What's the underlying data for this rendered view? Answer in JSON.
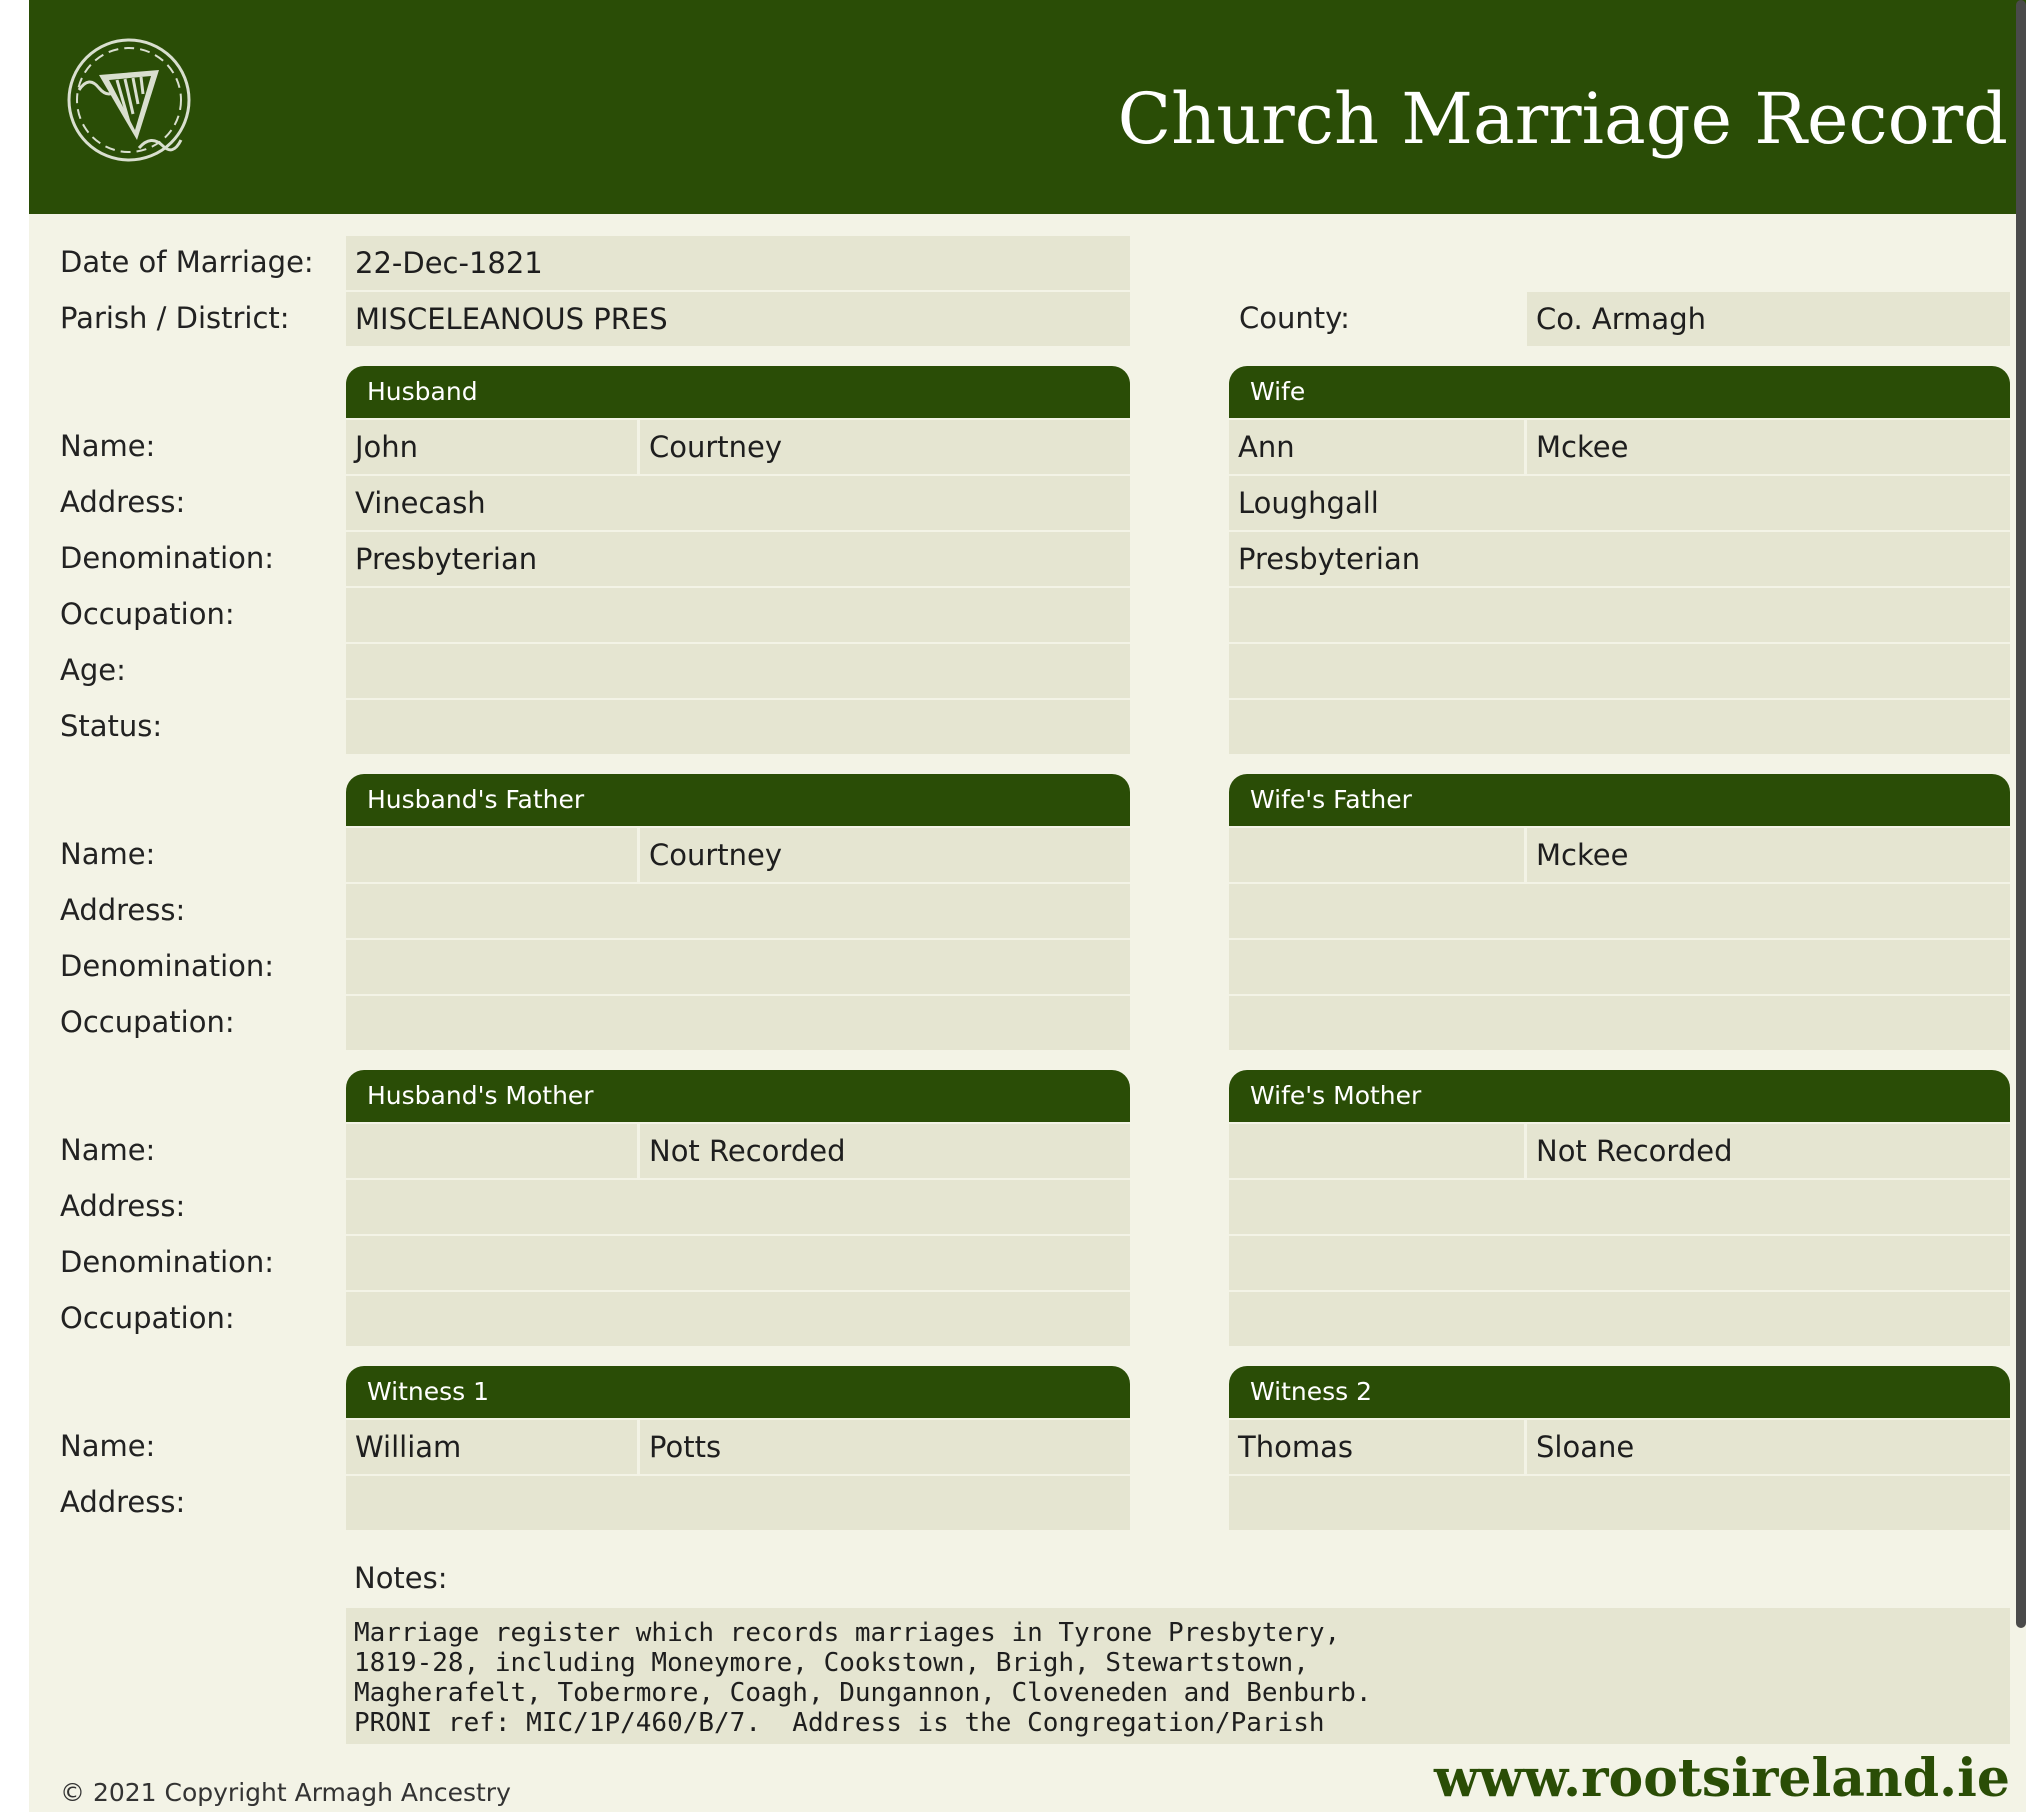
{
  "header": {
    "title": "Church Marriage Record"
  },
  "record": {
    "date_of_marriage": {
      "label": "Date of Marriage:",
      "value": "22-Dec-1821"
    },
    "parish": {
      "label": "Parish / District:",
      "value": "MISCELEANOUS PRES"
    },
    "county": {
      "label": "County:",
      "value": "Co. Armagh"
    }
  },
  "labels": {
    "name": "Name:",
    "address": "Address:",
    "denomination": "Denomination:",
    "occupation": "Occupation:",
    "age": "Age:",
    "status": "Status:"
  },
  "husband": {
    "heading": "Husband",
    "first_name": "John",
    "surname": "Courtney",
    "address": "Vinecash",
    "denomination": "Presbyterian",
    "occupation": "",
    "age": "",
    "status": ""
  },
  "wife": {
    "heading": "Wife",
    "first_name": "Ann",
    "surname": "Mckee",
    "address": "Loughgall",
    "denomination": "Presbyterian",
    "occupation": "",
    "age": "",
    "status": ""
  },
  "husbands_father": {
    "heading": "Husband's Father",
    "first_name": "",
    "surname": "Courtney",
    "address": "",
    "denomination": "",
    "occupation": ""
  },
  "wifes_father": {
    "heading": "Wife's Father",
    "first_name": "",
    "surname": "Mckee",
    "address": "",
    "denomination": "",
    "occupation": ""
  },
  "husbands_mother": {
    "heading": "Husband's Mother",
    "first_name": "",
    "surname": "Not Recorded",
    "address": "",
    "denomination": "",
    "occupation": ""
  },
  "wifes_mother": {
    "heading": "Wife's Mother",
    "first_name": "",
    "surname": "Not Recorded",
    "address": "",
    "denomination": "",
    "occupation": ""
  },
  "witness1": {
    "heading": "Witness 1",
    "first_name": "William",
    "surname": "Potts",
    "address": ""
  },
  "witness2": {
    "heading": "Witness 2",
    "first_name": "Thomas",
    "surname": "Sloane",
    "address": ""
  },
  "notes": {
    "label": "Notes:",
    "text": "Marriage register which records marriages in Tyrone Presbytery,\n1819-28, including Moneymore, Cookstown, Brigh, Stewartstown,\nMagherafelt, Tobermore, Coagh, Dungannon, Cloveneden and Benburb.\nPRONI ref: MIC/1P/460/B/7.  Address is the Congregation/Parish"
  },
  "footer": {
    "copyright": "© 2021 Copyright Armagh Ancestry",
    "website": "www.rootsireland.ie"
  },
  "icons": {
    "logo": "harp-logo-icon"
  },
  "colors": {
    "brand_green": "#2a4d06",
    "background": "#f3f3e6",
    "field": "#e5e5d1"
  }
}
